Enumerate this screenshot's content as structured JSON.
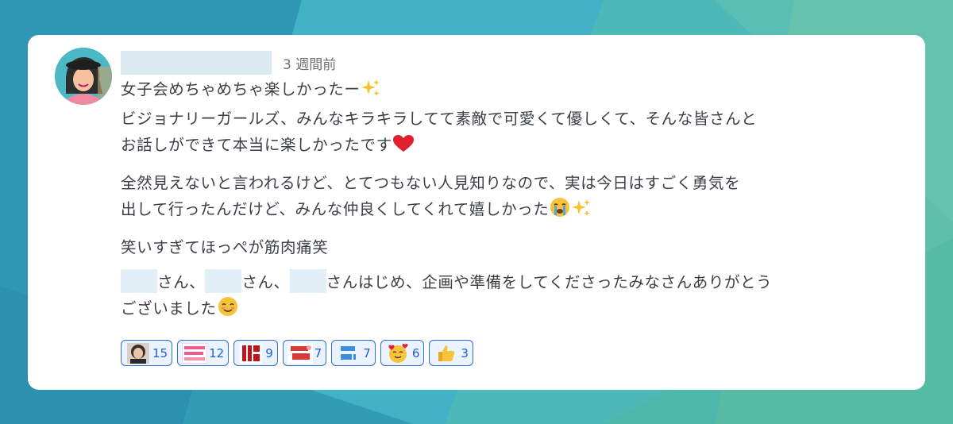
{
  "post": {
    "timestamp": "3 週間前",
    "paragraphs": {
      "p1_line1": "女子会めちゃめちゃ楽しかったー",
      "p1_line2": "ビジョナリーガールズ、みんなキラキラしてて素敵で可愛くて優しくて、そんな皆さんと",
      "p1_line3": "お話しができて本当に楽しかったです",
      "p2_line1": "全然見えないと言われるけど、とてつもない人見知りなので、実は今日はすごく勇気を",
      "p2_line2": "出して行ったんだけど、みんな仲良くしてくれて嬉しかった",
      "p3": "笑いすぎてほっぺが筋肉痛笑",
      "p4_seg1": "さん、",
      "p4_seg2": "さん、",
      "p4_seg3": "さんはじめ、企画や準備をしてくださったみなさんありがとう",
      "p4_line2": "ございました"
    }
  },
  "reactions": [
    {
      "icon": "portrait-sticker",
      "count": "15"
    },
    {
      "icon": "arigatou-gozaimasu-sticker",
      "count": "12"
    },
    {
      "icon": "kanji-stamp-sticker",
      "count": "9"
    },
    {
      "icon": "otsukaresama-sticker",
      "count": "7"
    },
    {
      "icon": "iine-sticker",
      "count": "7"
    },
    {
      "icon": "smiling-face-with-hearts",
      "count": "6"
    },
    {
      "icon": "thumbs-up",
      "count": "3"
    }
  ],
  "colors": {
    "accent": "#2f6fd6",
    "text": "#3b3f45",
    "muted": "#6a6e74",
    "card": "#ffffff"
  }
}
